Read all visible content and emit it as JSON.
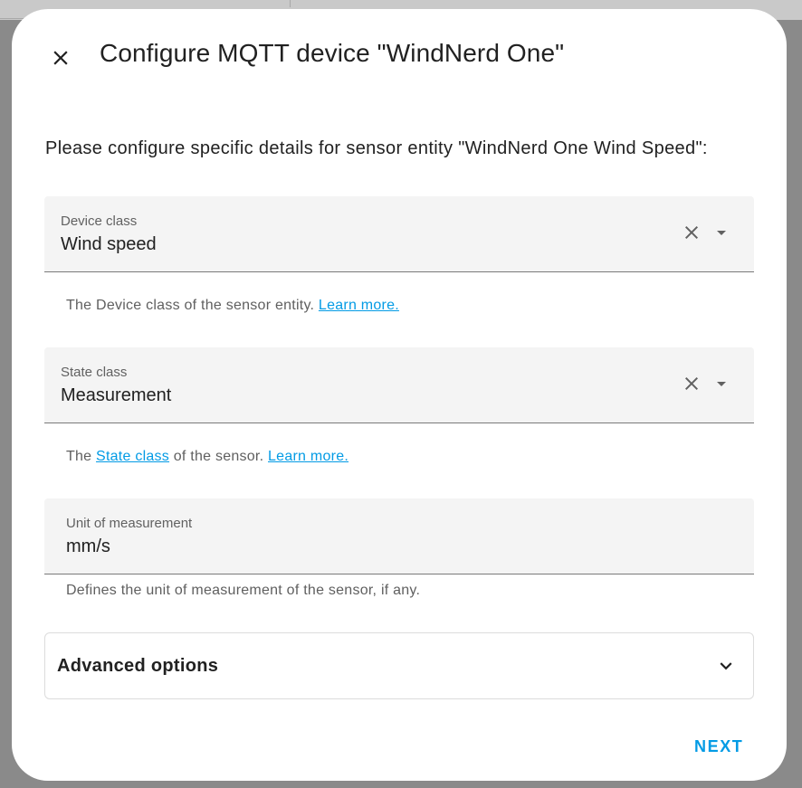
{
  "dialog": {
    "title": "Configure MQTT device \"WindNerd One\"",
    "intro": "Please configure specific details for sensor entity \"WindNerd One Wind Speed\":",
    "close_icon": "close-icon"
  },
  "device_class": {
    "label": "Device class",
    "value": "Wind speed",
    "helper_text": "The Device class of the sensor entity.",
    "helper_link": "Learn more."
  },
  "state_class": {
    "label": "State class",
    "value": "Measurement",
    "helper_prefix": "The",
    "helper_link_1": "State class",
    "helper_middle": "of the sensor.",
    "helper_link_2": "Learn more."
  },
  "unit": {
    "label": "Unit of measurement",
    "value": "mm/s",
    "helper_text": "Defines the unit of measurement of the sensor, if any."
  },
  "advanced": {
    "label": "Advanced options"
  },
  "actions": {
    "next_label": "NEXT"
  },
  "colors": {
    "accent": "#039be5",
    "field_bg": "#f4f4f4",
    "text": "#212121"
  }
}
